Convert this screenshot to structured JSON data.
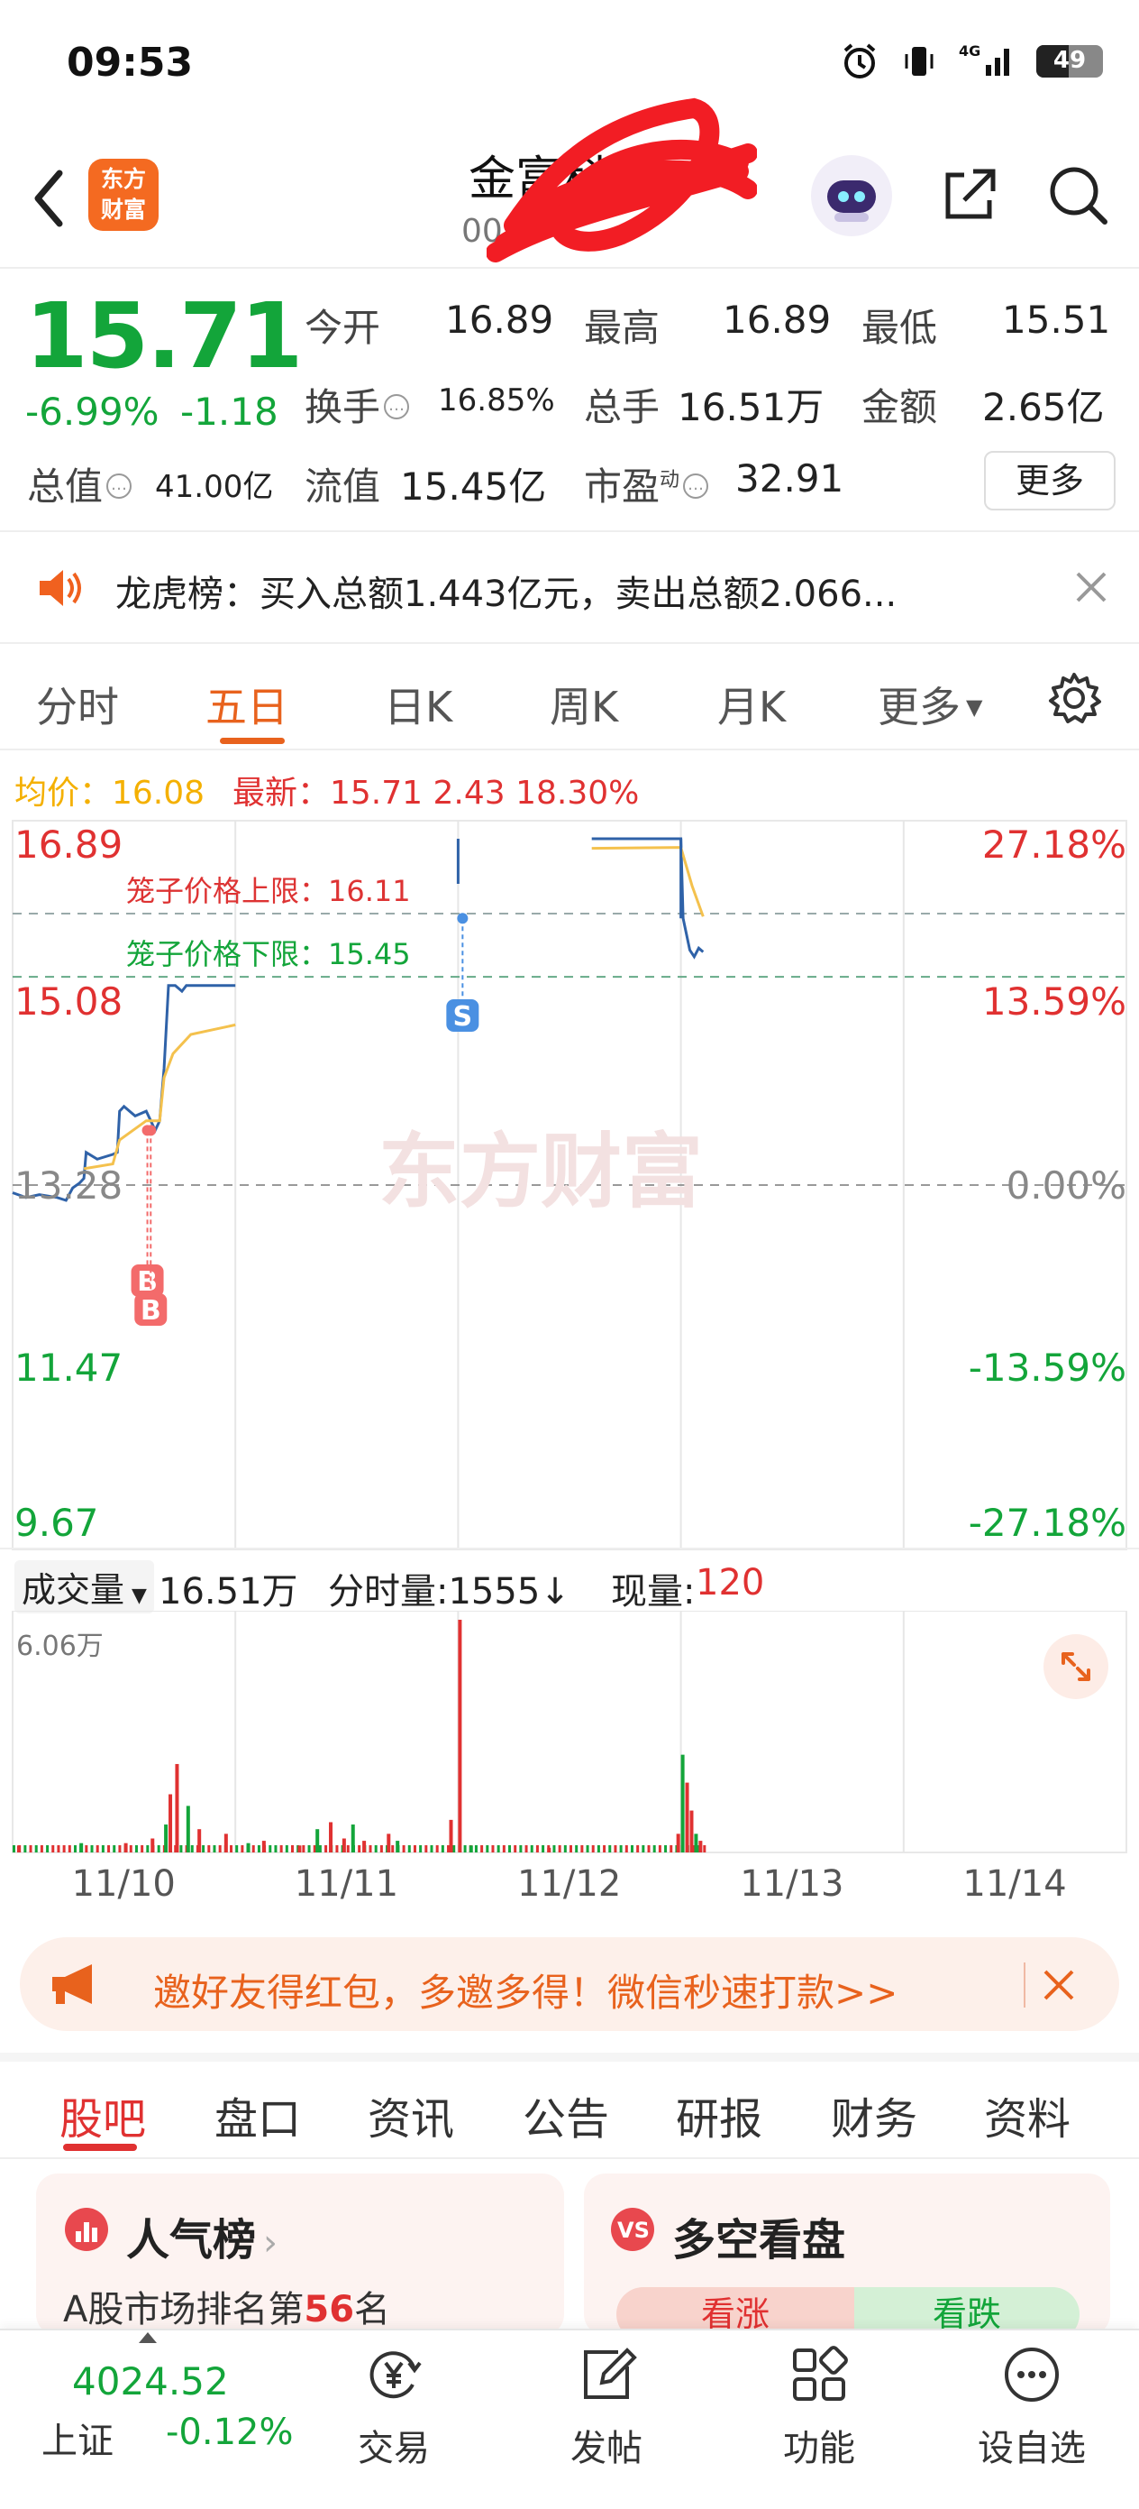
{
  "status_bar": {
    "time": "09:53",
    "battery": "49",
    "network": "4G"
  },
  "header": {
    "brand": [
      "东方",
      "财富"
    ],
    "stock_name": "金富科技",
    "stock_code": "00"
  },
  "quote": {
    "price": "15.71",
    "change_pct": "-6.99%",
    "change_val": "-1.18",
    "open_label": "今开",
    "open": "16.89",
    "high_label": "最高",
    "high": "16.89",
    "low_label": "最低",
    "low": "15.51",
    "turnover_label": "换手",
    "turnover": "16.85%",
    "volume_label": "总手",
    "volume": "16.51万",
    "amount_label": "金额",
    "amount": "2.65亿",
    "mcap_label": "总值",
    "mcap": "41.00亿",
    "float_label": "流值",
    "float": "15.45亿",
    "pe_label": "市盈",
    "pe_sup": "动",
    "pe": "32.91",
    "more_button": "更多"
  },
  "notice": {
    "text": "龙虎榜：买入总额1.443亿元，卖出总额2.066..."
  },
  "chart_tabs": [
    "分时",
    "五日",
    "日K",
    "周K",
    "月K",
    "更多"
  ],
  "chart_tabs_active": 1,
  "chart_info": {
    "avg": "均价：16.08",
    "latest": "最新：15.71  2.43  18.30%"
  },
  "chart_data": [
    {
      "type": "line",
      "x": [
        "11/10",
        "11/11",
        "11/12",
        "11/13",
        "11/14"
      ],
      "y_ticks_left": [
        "16.89",
        "15.08",
        "13.28",
        "11.47",
        "9.67"
      ],
      "y_ticks_right": [
        "27.18%",
        "13.59%",
        "0.00%",
        "-13.59%",
        "-27.18%"
      ],
      "ylim": [
        9.67,
        16.89
      ],
      "prev_close": 13.28,
      "annotations": [
        {
          "label": "笼子价格上限：16.11",
          "value": 16.11
        },
        {
          "label": "笼子价格下限：15.45",
          "value": 15.45
        }
      ],
      "markers": [
        "B",
        "B",
        "S"
      ],
      "series": [
        {
          "name": "price",
          "color": "#2f62a8",
          "points": [
            [
              0,
              13.2
            ],
            [
              0.06,
              13.15
            ],
            [
              0.12,
              13.18
            ],
            [
              0.2,
              13.15
            ],
            [
              0.24,
              13.12
            ],
            [
              0.27,
              13.25
            ],
            [
              0.3,
              13.3
            ],
            [
              0.32,
              13.35
            ],
            [
              0.33,
              13.62
            ],
            [
              0.38,
              13.55
            ],
            [
              0.45,
              13.6
            ],
            [
              0.47,
              13.62
            ],
            [
              0.48,
              14.05
            ],
            [
              0.5,
              14.1
            ],
            [
              0.55,
              14.0
            ],
            [
              0.6,
              14.05
            ],
            [
              0.62,
              13.95
            ],
            [
              0.64,
              13.85
            ],
            [
              0.66,
              13.95
            ],
            [
              0.68,
              14.5
            ],
            [
              0.7,
              15.36
            ],
            [
              0.73,
              15.36
            ],
            [
              0.76,
              15.3
            ],
            [
              0.78,
              15.36
            ],
            [
              0.85,
              15.36
            ],
            [
              1.0,
              15.36
            ],
            [
              2.0,
              16.89
            ],
            [
              2.6,
              16.89
            ],
            [
              3.0,
              16.89
            ],
            [
              3.01,
              16.06
            ],
            [
              3.04,
              15.73
            ],
            [
              3.06,
              15.66
            ],
            [
              3.08,
              15.75
            ],
            [
              3.1,
              15.71
            ]
          ]
        },
        {
          "name": "avg",
          "color": "#f4c14d",
          "points": [
            [
              0.32,
              13.45
            ],
            [
              0.45,
              13.5
            ],
            [
              0.48,
              13.75
            ],
            [
              0.6,
              13.95
            ],
            [
              0.66,
              13.95
            ],
            [
              0.68,
              14.4
            ],
            [
              0.72,
              14.65
            ],
            [
              0.8,
              14.85
            ],
            [
              0.9,
              14.9
            ],
            [
              1.0,
              14.95
            ],
            [
              2.0,
              16.75
            ],
            [
              2.6,
              16.79
            ],
            [
              3.0,
              16.8
            ],
            [
              3.05,
              16.4
            ],
            [
              3.1,
              16.08
            ]
          ]
        }
      ]
    },
    {
      "type": "bar",
      "title": "成交量",
      "total": "16.51万",
      "minute_volume": "分时量:1555↓",
      "current_volume_label": "现量:",
      "current_volume": "120",
      "ymax": "6.06万"
    }
  ],
  "promo": {
    "text": "邀好友得红包，多邀多得！微信秒速打款>>"
  },
  "bottom_tabs": [
    "股吧",
    "盘口",
    "资讯",
    "公告",
    "研报",
    "财务",
    "资料"
  ],
  "cards": {
    "popularity_title": "人气榜",
    "popularity_sub_prefix": "A股市场排名第",
    "popularity_rank": "56",
    "popularity_sub_suffix": "名",
    "bullbear_title": "多空看盘",
    "bull": "看涨",
    "bear": "看跌"
  },
  "bottom_nav": {
    "index_value": "4024.52",
    "index_name": "上证",
    "index_change": "-0.12%",
    "items": [
      "交易",
      "发帖",
      "功能",
      "设自选"
    ]
  }
}
